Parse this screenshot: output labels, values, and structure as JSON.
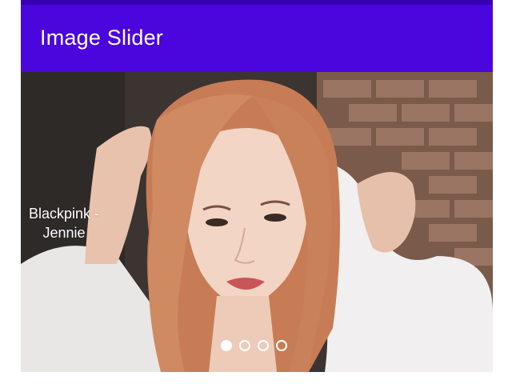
{
  "app_bar": {
    "title": "Image Slider",
    "color": "#4a06dd",
    "status_color": "#3700b3"
  },
  "slider": {
    "slides": [
      {
        "caption": "Blackpink - Jennie",
        "image": "portrait-photo"
      }
    ],
    "current_slide": 1,
    "slide_count": 4
  }
}
